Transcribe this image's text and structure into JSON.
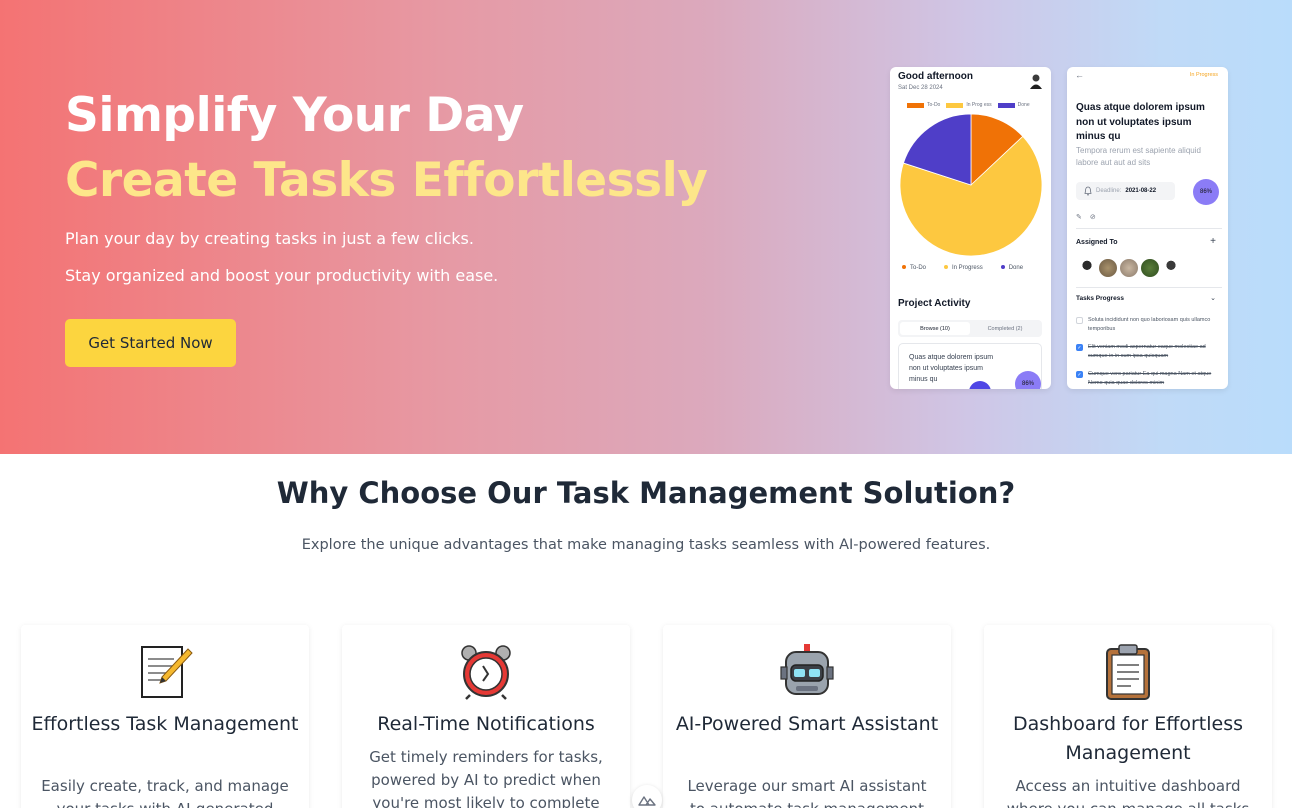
{
  "hero": {
    "title_line1": "Simplify Your Day",
    "title_line2": "Create Tasks Effortlessly",
    "subtitle_line1": "Plan your day by creating tasks in just a few clicks.",
    "subtitle_line2": "Stay organized and boost your productivity with ease.",
    "cta_label": "Get Started Now"
  },
  "dashboard_mock": {
    "greeting": "Good afternoon",
    "date": "Sat Dec 28 2024",
    "legend": [
      "To-Do",
      "In Progress",
      "Done"
    ],
    "legend_top": [
      "To-Do",
      "In Prog ess",
      "Done"
    ],
    "chart_data": {
      "type": "pie",
      "labels": [
        "To-Do",
        "In Progress",
        "Done"
      ],
      "values": [
        0.13,
        0.67,
        0.2
      ],
      "colors": [
        "#f07206",
        "#fdc840",
        "#4f3ec8"
      ]
    },
    "project_activity_title": "Project Activity",
    "tabs": [
      "Browse (10)",
      "Completed (2)"
    ],
    "card_text": "Quas atque dolorem ipsum non ut voluptates ipsum minus qu",
    "card_badge": "86%"
  },
  "task_detail_mock": {
    "back": "←",
    "status": "In Progress",
    "title": "Quas atque dolorem ipsum non ut voluptates ipsum minus qu",
    "description": "Tempora rerum est sapiente aliquid labore aut aut ad sits",
    "deadline_label": "Deadline:",
    "deadline_value": "2021-08-22",
    "progress_badge": "86%",
    "assigned_to": "Assigned To",
    "add": "+",
    "tasks_progress": "Tasks Progress",
    "chevron": "⌄",
    "tasks": [
      {
        "text": "Soluta incididunt non quo laboriosam quis ullamco temporibus",
        "done": false
      },
      {
        "text": "Elit veniam modi aspernatur eaque molestiae ad cumque in in cum ipsa quisquam",
        "done": true
      },
      {
        "text": "Cumque vero pariatur Ea qui magna Nam et atque Nemo quia quae dolores minim",
        "done": true
      }
    ]
  },
  "features": {
    "title": "Why Choose Our Task Management Solution?",
    "subtitle": "Explore the unique advantages that make managing tasks seamless with AI-powered features.",
    "cards": [
      {
        "icon": "memo-icon",
        "title": "Effortless Task Management",
        "desc": "Easily create, track, and manage your tasks with AI-generated"
      },
      {
        "icon": "alarm-clock-icon",
        "title": "Real-Time Notifications",
        "desc": "Get timely reminders for tasks, powered by AI to predict when you're most likely to complete"
      },
      {
        "icon": "robot-icon",
        "title": "AI-Powered Smart Assistant",
        "desc": "Leverage our smart AI assistant to automate task management"
      },
      {
        "icon": "clipboard-icon",
        "title": "Dashboard for Effortless Management",
        "desc": "Access an intuitive dashboard where you can manage all tasks"
      }
    ]
  }
}
